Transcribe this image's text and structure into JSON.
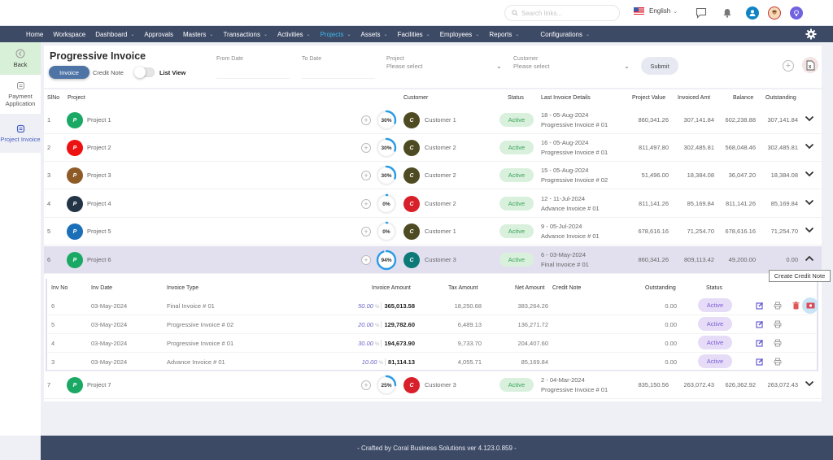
{
  "topbar": {
    "search_placeholder": "Search links...",
    "language": "English",
    "icons": [
      "chat-icon",
      "bell-icon",
      "user-icon",
      "profile-avatar",
      "idea-bulb-icon"
    ]
  },
  "nav": {
    "items": [
      {
        "label": "Home",
        "dropdown": false
      },
      {
        "label": "Workspace",
        "dropdown": false
      },
      {
        "label": "Dashboard",
        "dropdown": true
      },
      {
        "label": "Approvals",
        "dropdown": false
      },
      {
        "label": "Masters",
        "dropdown": true
      },
      {
        "label": "Transactions",
        "dropdown": true
      },
      {
        "label": "Activities",
        "dropdown": true
      },
      {
        "label": "Projects",
        "dropdown": true,
        "active": true
      },
      {
        "label": "Assets",
        "dropdown": true
      },
      {
        "label": "Facilities",
        "dropdown": true
      },
      {
        "label": "Employees",
        "dropdown": true
      },
      {
        "label": "Reports",
        "dropdown": true
      },
      {
        "label": "Configurations",
        "dropdown": true
      }
    ]
  },
  "sidebar": {
    "items": [
      {
        "label": "Back",
        "icon": "back-icon"
      },
      {
        "label": "Payment Application",
        "icon": "document-icon"
      },
      {
        "label": "Project Invoice",
        "icon": "document-icon",
        "active": true
      }
    ]
  },
  "header": {
    "title": "Progressive Invoice",
    "tab_invoice": "Invoice",
    "tab_credit_note": "Credit Note",
    "list_view_label": "List View",
    "list_view_on": false,
    "from_date_label": "From Date",
    "to_date_label": "To Date",
    "project_label": "Project",
    "project_value": "Please select",
    "customer_label": "Customer",
    "customer_value": "Please select",
    "submit_label": "Submit"
  },
  "table": {
    "columns": {
      "slno": "SlNo",
      "project": "Project",
      "customer": "Customer",
      "status": "Status",
      "last_invoice": "Last Invoice Details",
      "project_value": "Project Value",
      "invoiced_amt": "Invoiced Amt",
      "balance": "Balance",
      "outstanding": "Outstanding"
    },
    "rows": [
      {
        "slno": "1",
        "initial": "P",
        "project": "Project 1",
        "project_color": "#1aa865",
        "progress": 30,
        "progress_label": "30%",
        "cust_initial": "C",
        "customer": "Customer 1",
        "cust_color": "#4e4a22",
        "status": "Active",
        "last_line1": "18 - 05-Aug-2024",
        "last_line2": "Progressive Invoice # 01",
        "project_value": "860,341.26",
        "invoiced_amt": "307,141.84",
        "balance": "602,238.88",
        "outstanding": "307,141.84",
        "expanded": false
      },
      {
        "slno": "2",
        "initial": "P",
        "project": "Project 2",
        "project_color": "#ee1111",
        "progress": 30,
        "progress_label": "30%",
        "cust_initial": "C",
        "customer": "Customer 2",
        "cust_color": "#4e4a22",
        "status": "Active",
        "last_line1": "16 - 05-Aug-2024",
        "last_line2": "Progressive Invoice # 01",
        "project_value": "811,497.80",
        "invoiced_amt": "302,485.81",
        "balance": "568,048.46",
        "outstanding": "302,485.81",
        "expanded": false
      },
      {
        "slno": "3",
        "initial": "P",
        "project": "Project 3",
        "project_color": "#8e5a26",
        "progress": 30,
        "progress_label": "30%",
        "cust_initial": "C",
        "customer": "Customer 2",
        "cust_color": "#4e4a22",
        "status": "Active",
        "last_line1": "15 - 05-Aug-2024",
        "last_line2": "Progressive Invoice # 02",
        "project_value": "51,496.00",
        "invoiced_amt": "18,384.08",
        "balance": "36,047.20",
        "outstanding": "18,384.08",
        "expanded": false
      },
      {
        "slno": "4",
        "initial": "P",
        "project": "Project 4",
        "project_color": "#233447",
        "progress": 0,
        "progress_label": "0%",
        "cust_initial": "C",
        "customer": "Customer 2",
        "cust_color": "#d8202a",
        "status": "Active",
        "last_line1": "12 - 11-Jul-2024",
        "last_line2": "Advance Invoice # 01",
        "project_value": "811,141.26",
        "invoiced_amt": "85,169.84",
        "balance": "811,141.26",
        "outstanding": "85,169.84",
        "expanded": false
      },
      {
        "slno": "5",
        "initial": "P",
        "project": "Project 5",
        "project_color": "#1a6fb8",
        "progress": 0,
        "progress_label": "0%",
        "cust_initial": "C",
        "customer": "Customer 1",
        "cust_color": "#4e4a22",
        "status": "Active",
        "last_line1": "9 - 05-Jul-2024",
        "last_line2": "Advance Invoice # 01",
        "project_value": "678,616.16",
        "invoiced_amt": "71,254.70",
        "balance": "678,616.16",
        "outstanding": "71,254.70",
        "expanded": false
      },
      {
        "slno": "6",
        "initial": "P",
        "project": "Project 6",
        "project_color": "#1aa865",
        "progress": 94,
        "progress_label": "94%",
        "cust_initial": "C",
        "customer": "Customer 3",
        "cust_color": "#0d7a78",
        "status": "Active",
        "last_line1": "6 - 03-May-2024",
        "last_line2": "Final Invoice # 01",
        "project_value": "860,341.26",
        "invoiced_amt": "809,113.42",
        "balance": "49,200.00",
        "outstanding": "0.00",
        "expanded": true
      },
      {
        "slno": "7",
        "initial": "P",
        "project": "Project 7",
        "project_color": "#1aa865",
        "progress": 25,
        "progress_label": "25%",
        "cust_initial": "C",
        "customer": "Customer 3",
        "cust_color": "#d8202a",
        "status": "Active",
        "last_line1": "2 - 04-Mar-2024",
        "last_line2": "Progressive Invoice # 01",
        "project_value": "835,150.56",
        "invoiced_amt": "263,072.43",
        "balance": "626,362.92",
        "outstanding": "263,072.43",
        "expanded": false
      }
    ]
  },
  "subtable": {
    "columns": {
      "inv_no": "Inv No",
      "inv_date": "Inv Date",
      "invoice_type": "Invoice Type",
      "invoice_amount": "Invoice Amount",
      "tax_amount": "Tax Amount",
      "net_amount": "Net Amount",
      "credit_note": "Credit Note",
      "outstanding": "Outstanding",
      "status": "Status"
    },
    "rows": [
      {
        "inv_no": "6",
        "inv_date": "03-May-2024",
        "invoice_type": "Final Invoice # 01",
        "percent": "50.00",
        "pct_sym": "%",
        "invoice_amount": "365,013.58",
        "tax_amount": "18,250.68",
        "net_amount": "383,264.26",
        "credit_note": "",
        "outstanding": "0.00",
        "status": "Active",
        "actions": [
          "edit",
          "print",
          "delete",
          "create-credit-note"
        ]
      },
      {
        "inv_no": "5",
        "inv_date": "03-May-2024",
        "invoice_type": "Progressive Invoice # 02",
        "percent": "20.00",
        "pct_sym": "%",
        "invoice_amount": "129,782.60",
        "tax_amount": "6,489.13",
        "net_amount": "136,271.72",
        "credit_note": "",
        "outstanding": "0.00",
        "status": "Active",
        "actions": [
          "edit",
          "print"
        ]
      },
      {
        "inv_no": "4",
        "inv_date": "03-May-2024",
        "invoice_type": "Progressive Invoice # 01",
        "percent": "30.00",
        "pct_sym": "%",
        "invoice_amount": "194,673.90",
        "tax_amount": "9,733.70",
        "net_amount": "204,407.60",
        "credit_note": "",
        "outstanding": "0.00",
        "status": "Active",
        "actions": [
          "edit",
          "print"
        ]
      },
      {
        "inv_no": "3",
        "inv_date": "03-May-2024",
        "invoice_type": "Advance Invoice # 01",
        "percent": "10.00",
        "pct_sym": "%",
        "invoice_amount": "81,114.13",
        "tax_amount": "4,055.71",
        "net_amount": "85,169.84",
        "credit_note": "",
        "outstanding": "0.00",
        "status": "Active",
        "actions": [
          "edit",
          "print"
        ]
      }
    ]
  },
  "tooltip": "Create Credit Note",
  "colors": {
    "nav_bg": "#3d4a66",
    "nav_active": "#3fb7e8",
    "active_pill_bg": "#d9f0dd",
    "active_pill_text": "#3aa35a",
    "sub_pill_bg": "#e6dcf7",
    "sub_pill_text": "#7b5cd6",
    "progress_ring": "#2a9be6",
    "expanded_row_bg": "#e2e0ef"
  },
  "footer": {
    "text": "- Crafted by Coral Business Solutions ver 4.123.0.859 -"
  }
}
